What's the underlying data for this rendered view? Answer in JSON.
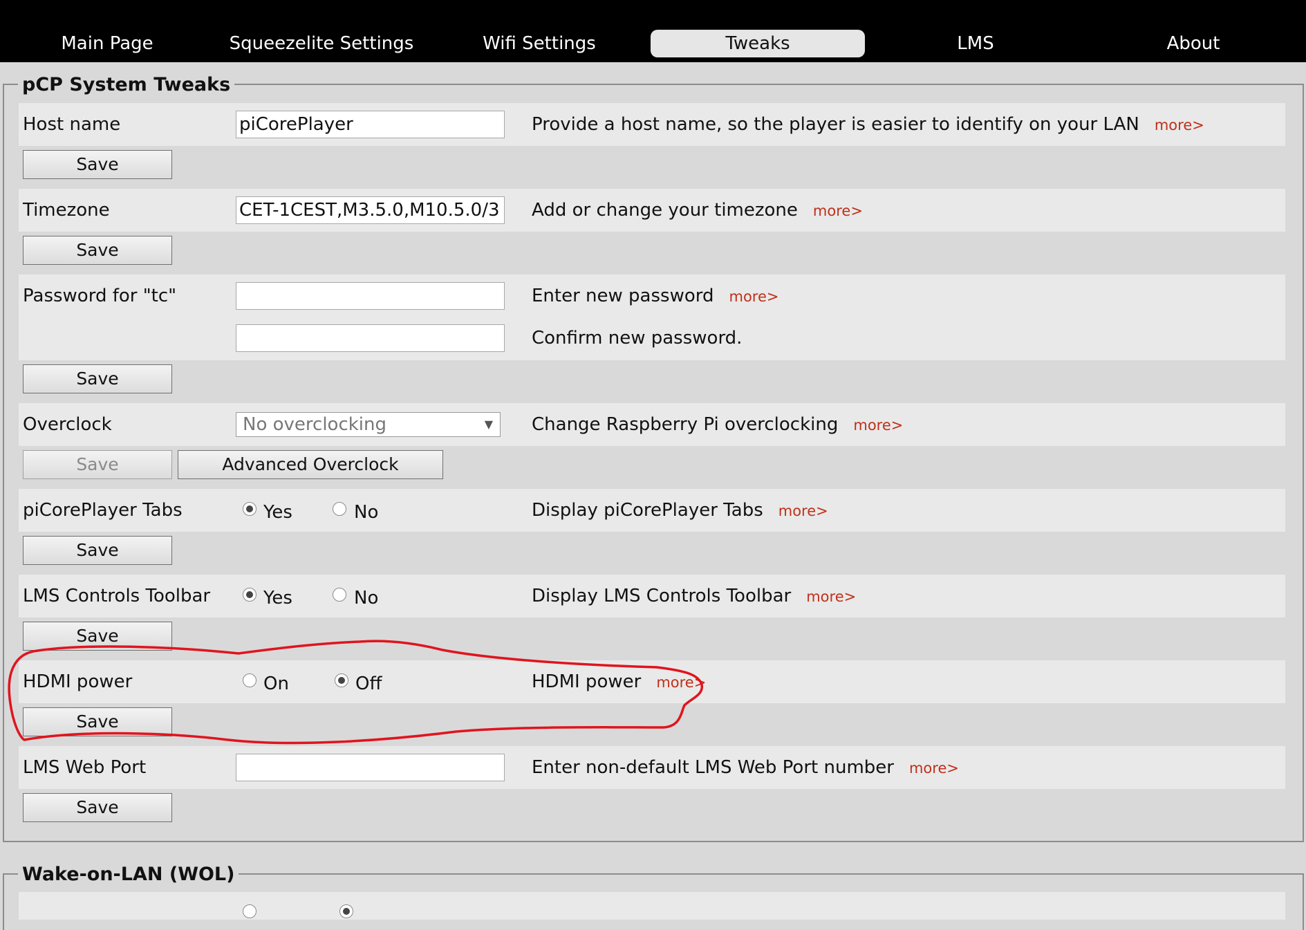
{
  "nav": {
    "tabs": [
      "Main Page",
      "Squeezelite Settings",
      "Wifi Settings",
      "Tweaks",
      "LMS",
      "About"
    ],
    "active": "Tweaks"
  },
  "system_tweaks": {
    "legend": "pCP System Tweaks",
    "more_label": "more>",
    "hostname": {
      "label": "Host name",
      "value": "piCorePlayer",
      "help": "Provide a host name, so the player is easier to identify on your LAN",
      "save": "Save"
    },
    "timezone": {
      "label": "Timezone",
      "value": "CET-1CEST,M3.5.0,M10.5.0/3",
      "help": "Add or change your timezone",
      "save": "Save"
    },
    "password": {
      "label": "Password for \"tc\"",
      "help": "Enter new password",
      "confirm_help": "Confirm new password.",
      "save": "Save"
    },
    "overclock": {
      "label": "Overclock",
      "selected": "No overclocking",
      "help": "Change Raspberry Pi overclocking",
      "save": "Save",
      "advanced": "Advanced Overclock"
    },
    "tabs": {
      "label": "piCorePlayer Tabs",
      "yes": "Yes",
      "no": "No",
      "selected": "Yes",
      "help": "Display piCorePlayer Tabs",
      "save": "Save"
    },
    "toolbar": {
      "label": "LMS Controls Toolbar",
      "yes": "Yes",
      "no": "No",
      "selected": "Yes",
      "help": "Display LMS Controls Toolbar",
      "save": "Save"
    },
    "hdmi": {
      "label": "HDMI power",
      "on": "On",
      "off": "Off",
      "selected": "Off",
      "help": "HDMI power",
      "save": "Save"
    },
    "webport": {
      "label": "LMS Web Port",
      "value": "",
      "help": "Enter non-default LMS Web Port number",
      "save": "Save"
    }
  },
  "wol": {
    "legend": "Wake-on-LAN (WOL)"
  },
  "colors": {
    "annotation": "#e0141e",
    "more_link": "#c0301a",
    "nav_bg": "#000000"
  }
}
